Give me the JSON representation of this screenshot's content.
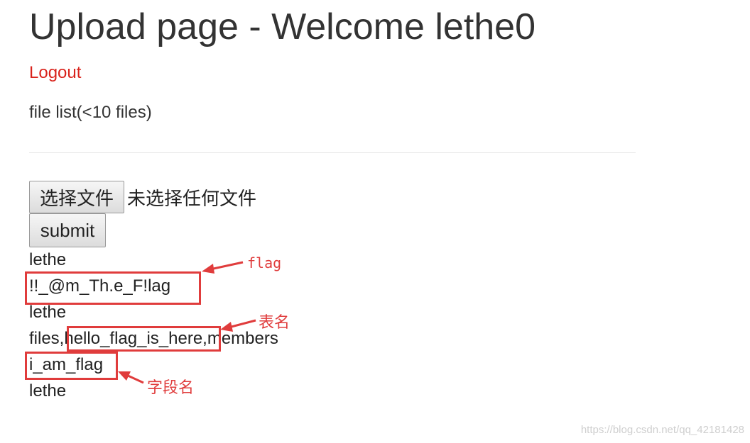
{
  "header": {
    "title": "Upload page - Welcome lethe0"
  },
  "nav": {
    "logout_label": "Logout"
  },
  "files": {
    "list_label": "file list(<10 files)"
  },
  "upload": {
    "choose_button_label": "选择文件",
    "no_file_text": "未选择任何文件",
    "submit_label": "submit"
  },
  "output": {
    "line1": "lethe",
    "line2": "!!_@m_Th.e_F!lag",
    "line3": "lethe",
    "line4_prefix": "files,",
    "line4_highlight": "hello_flag_is_here",
    "line4_suffix": ",members",
    "line5": "i_am_flag",
    "line6": "lethe"
  },
  "annotations": {
    "flag": "flag",
    "table_name": "表名",
    "field_name": "字段名",
    "color": "#e03c3c"
  },
  "watermark": "https://blog.csdn.net/qq_42181428"
}
